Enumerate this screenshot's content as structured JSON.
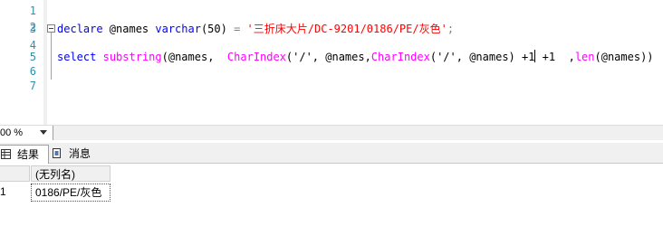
{
  "editor": {
    "line_numbers": [
      "1",
      "2",
      "3",
      "4",
      "5",
      "6",
      "7"
    ],
    "line3": {
      "kw_declare": "declare",
      "var": " @names ",
      "kw_type": "varchar",
      "size": "(50)",
      "eq": " = ",
      "str": "'三折床大片/DC-9201/0186/PE/灰色'",
      "semi": ";"
    },
    "line5": {
      "kw_select": "select",
      "sp1": " ",
      "fn_substring": "substring",
      "p1": "(@names,  ",
      "fn_charindex1": "CharIndex",
      "p2": "('/', @names,",
      "fn_charindex2": "CharIndex",
      "p3": "('/', @names) +1",
      "p4": " +1  ,",
      "fn_len": "len",
      "p5": "(@names))"
    }
  },
  "statusbar": {
    "zoom": "00 %"
  },
  "result_tabs": [
    {
      "label": "结果",
      "icon": "grid-icon",
      "active": true
    },
    {
      "label": "消息",
      "icon": "messages-icon",
      "active": false
    }
  ],
  "results": {
    "columns": [
      "(无列名)"
    ],
    "rows": [
      {
        "num": "1",
        "cells": [
          "0186/PE/灰色"
        ]
      }
    ]
  },
  "colors": {
    "keyword": "#0000ff",
    "function": "#ff00ff",
    "string": "#ff0000",
    "line_number": "#2b91af"
  }
}
